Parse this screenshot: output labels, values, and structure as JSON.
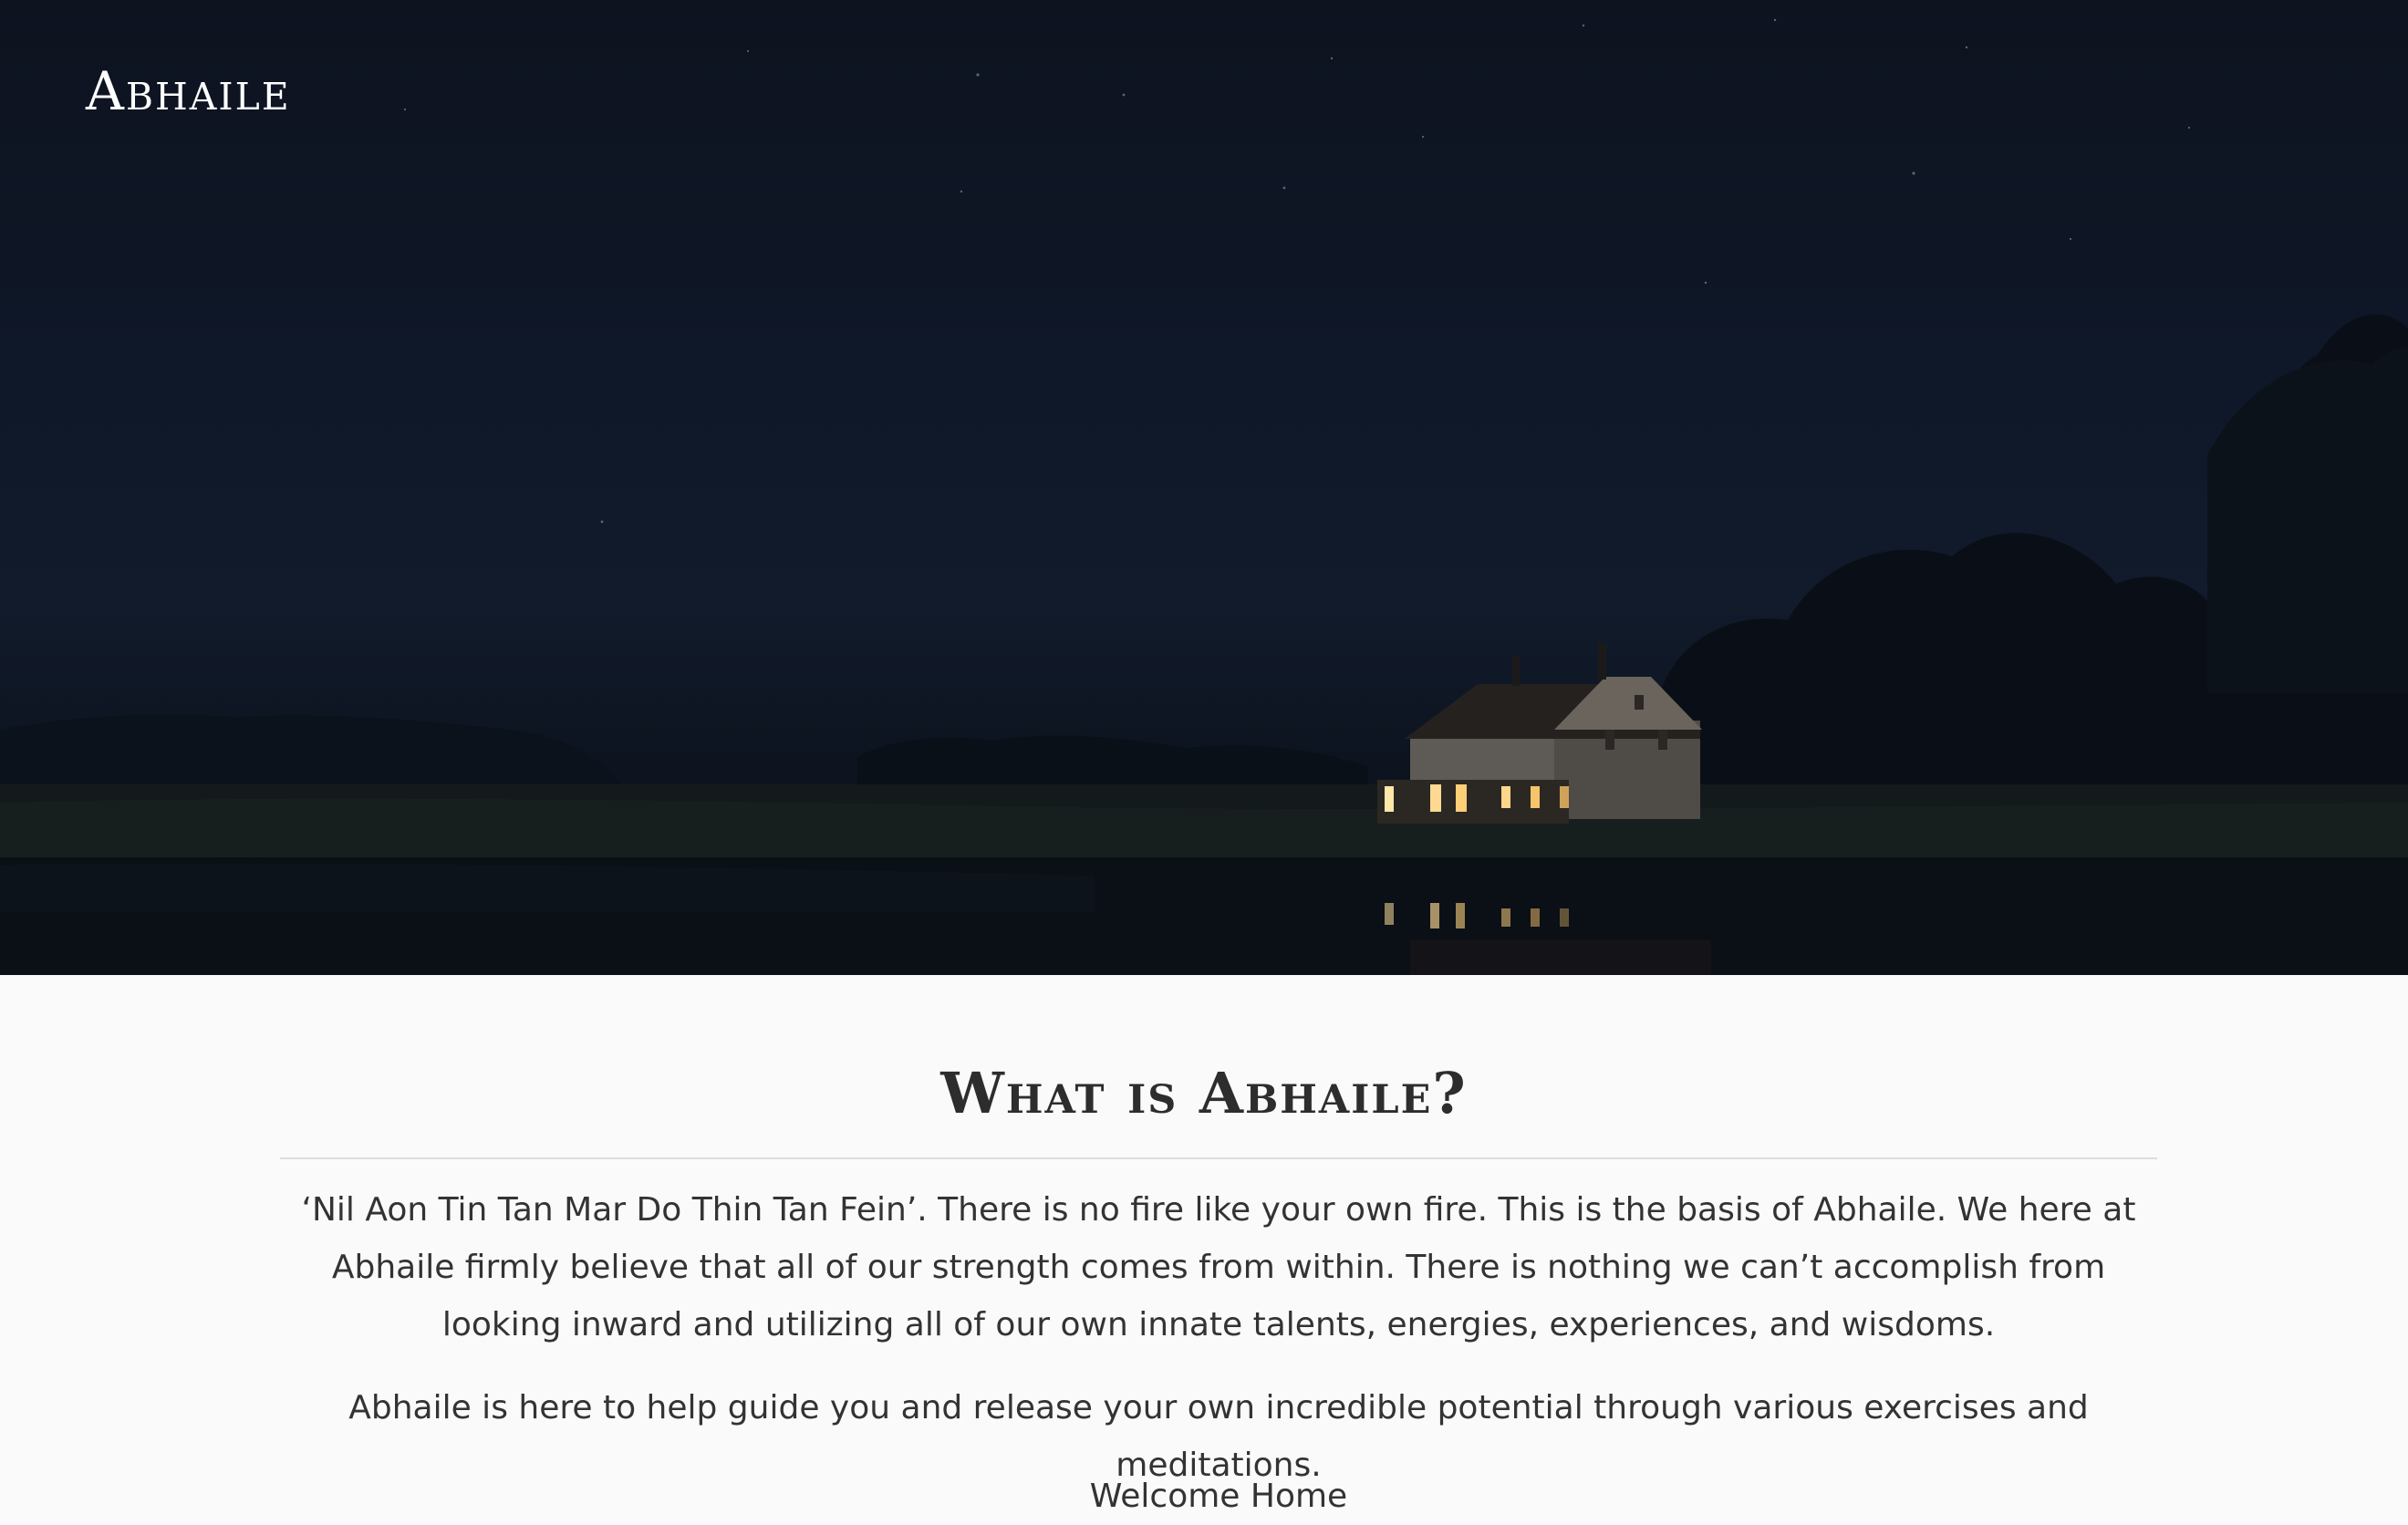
{
  "header": {
    "logo": "Abhaile",
    "icons": [
      "menu-icon",
      "search-icon",
      "account-icon",
      "cart-icon"
    ]
  },
  "hero": {
    "scene": "night sky over a lit house by the water"
  },
  "about": {
    "title": "What is Abhaile?",
    "paragraph_1": "‘Nil Aon Tin Tan Mar Do Thin Tan Fein’. There is no fire like your own fire. This is the basis of Abhaile. We here at Abhaile firmly believe that all of our strength comes from within. There is nothing we can’t accomplish from looking inward and utilizing all of our own innate talents, energies, experiences, and wisdoms.",
    "paragraph_2": "Abhaile is here to help guide you and release your own incredible potential through various exercises and meditations.",
    "paragraph_3": "Welcome Home"
  },
  "colors": {
    "hero_sky": "#0f1829",
    "header_text": "#ffffff",
    "body_text": "#333333",
    "page_background": "#fafafa",
    "divider": "#dcdcdc"
  }
}
